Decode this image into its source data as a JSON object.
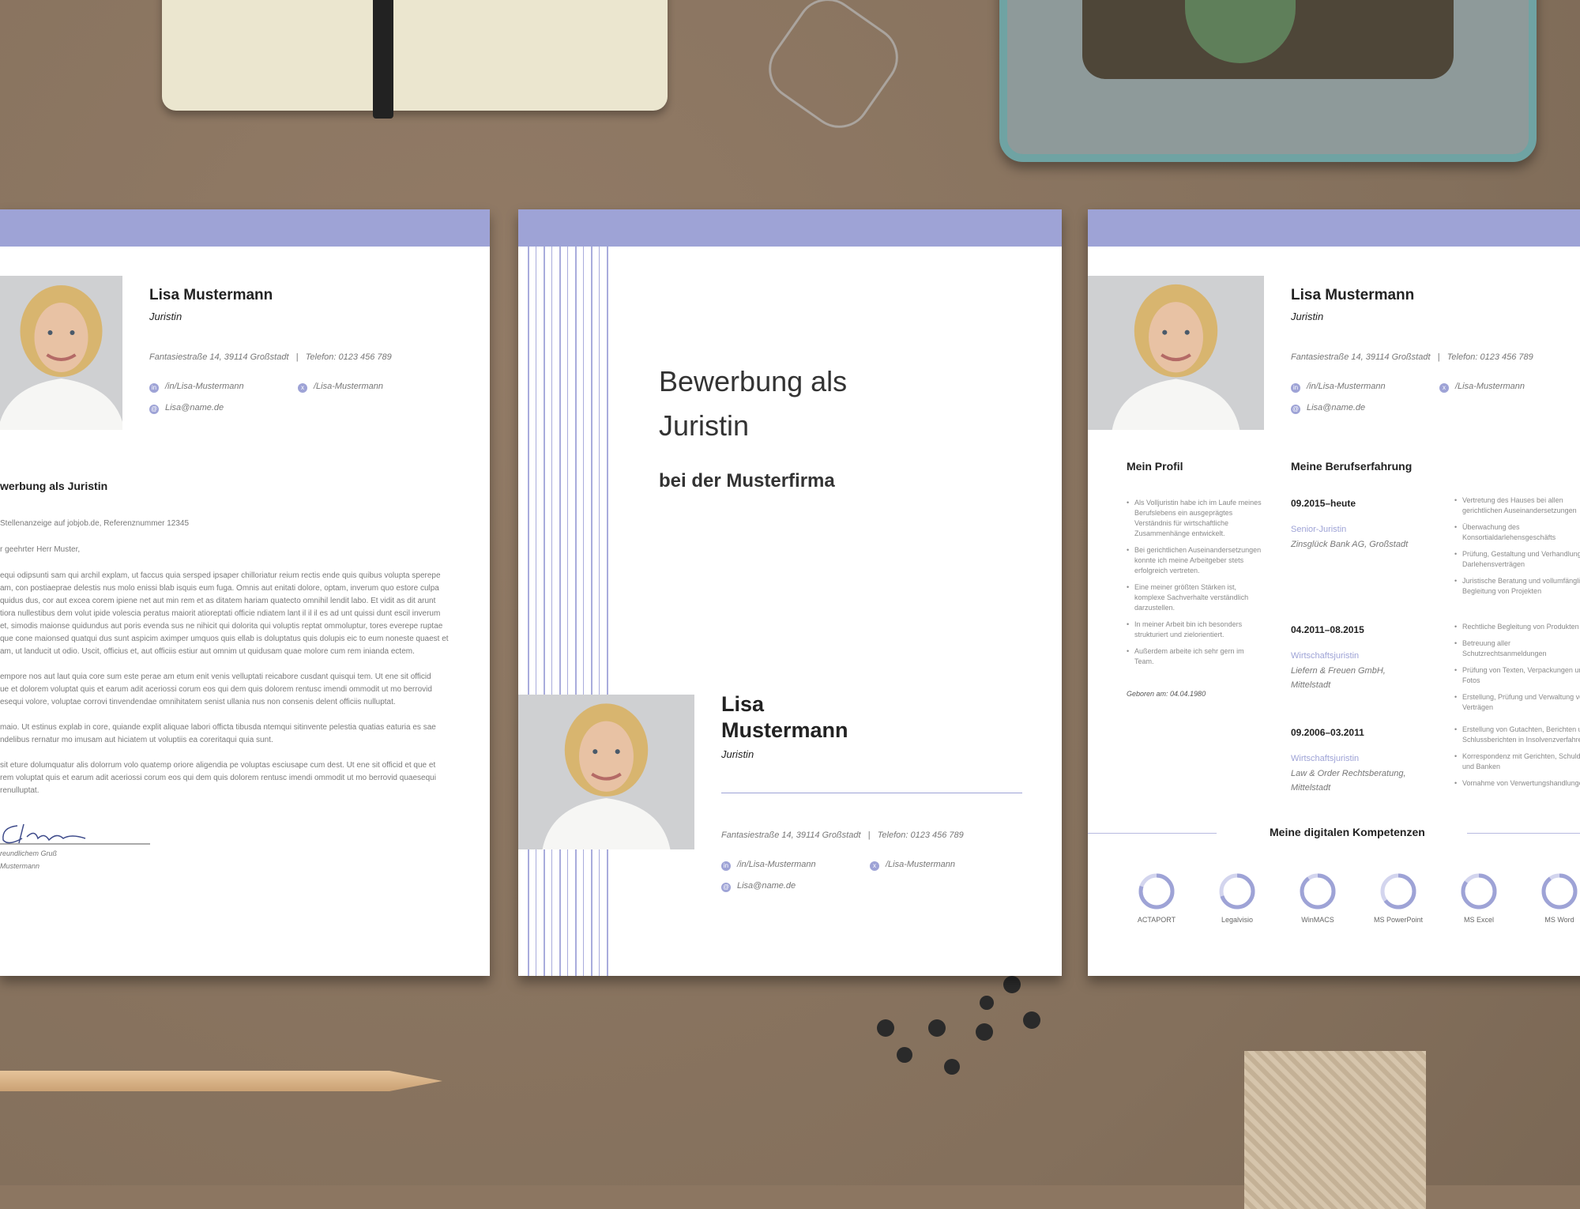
{
  "accent_color": "#9ea3d6",
  "person": {
    "name": "Lisa Mustermann",
    "name_line1": "Lisa",
    "name_line2": "Mustermann",
    "role": "Juristin",
    "address": "Fantasiestraße 14, 39114 Großstadt   |   Telefon: 0123 456 789",
    "linkedin": "/in/Lisa-Mustermann",
    "xing": "/Lisa-Mustermann",
    "email": "Lisa@name.de"
  },
  "icons": {
    "linkedin": "linkedin-icon",
    "xing": "xing-icon",
    "email": "at-icon"
  },
  "letter": {
    "subject": "werbung als Juristin",
    "reference": "Stellenanzeige auf jobjob.de, Referenznummer 12345",
    "salutation": "r geehrter Herr Muster,",
    "paragraphs": [
      [
        "equi odipsunti sam qui archil explam, ut faccus quia sersped ipsaper chilloriatur reium rectis ende quis quibus volupta sperepe",
        "am, con postiaeprae delestis nus molo enissi blab isquis eum fuga. Omnis aut enitati dolore, optam, inverum quo estore culpa",
        "quidus dus, cor aut excea corem ipiene net aut min rem et as ditatem hariam quatecto omnihil lendit labo. Et vidit as dit arunt",
        "tiora nullestibus dem volut ipide volescia peratus maiorit atioreptati officie ndiatem lant il il il es ad unt quissi dunt escil inverum",
        "et, simodis maionse quidundus aut poris evenda sus ne nihicit qui dolorita qui voluptis reptat ommoluptur, tores everepe ruptae",
        "que cone maionsed quatqui dus sunt aspicim aximper umquos quis ellab is doluptatus quis dolupis eic to eum noneste quaest et",
        "am, ut landucit ut odio. Uscit, officius et, aut officiis estiur aut omnim ut quidusam quae molore cum rem inianda ectem."
      ],
      [
        "empore nos aut laut quia core sum este perae am etum enit venis velluptati reicabore cusdant quisqui tem. Ut ene sit officid",
        "ue et dolorem voluptat quis et earum adit aceriossi corum eos qui dem quis dolorem rentusc imendi ommodit ut mo berrovid",
        "esequi volore, voluptae corrovi tinvendendae omnihitatem senist ullania nus non consenis delent officiis nulluptat."
      ],
      [
        "maio. Ut estinus explab in core, quiande explit aliquae labori officta tibusda ntemqui sitinvente pelestia quatias eaturia es sae",
        "ndelibus rernatur mo imusam aut hiciatem ut voluptiis ea coreritaqui quia sunt."
      ],
      [
        "sit eture dolumquatur alis dolorrum volo quatemp oriore aligendia pe voluptas esciusape cum dest. Ut ene sit officid et que et",
        "rem voluptat quis et earum adit aceriossi corum eos qui dem quis dolorem rentusc imendi ommodit ut mo berrovid quaesequi",
        "renulluptat."
      ]
    ],
    "closing": "reundlichem Gruß",
    "closing_name": "Mustermann"
  },
  "cover": {
    "title_line1": "Bewerbung als",
    "title_line2": "Juristin",
    "subtitle": "bei der Musterfirma"
  },
  "cv": {
    "profile_heading": "Mein Profil",
    "profile": [
      "Als Volljuristin habe ich im Laufe meines Berufslebens ein ausgeprägtes Verständnis für wirtschaftliche Zusammenhänge entwickelt.",
      "Bei gerichtlichen Auseinandersetzungen konnte ich meine Arbeitgeber stets erfolgreich vertreten.",
      "Eine meiner größten Stärken ist, komplexe Sachverhalte verständlich darzustellen.",
      "In meiner Arbeit bin ich besonders strukturiert und zielorientiert.",
      "Außerdem arbeite ich sehr gern im Team."
    ],
    "born": "Geboren am: 04.04.1980",
    "experience_heading": "Meine Berufserfahrung",
    "jobs": [
      {
        "dates": "09.2015–heute",
        "title": "Senior-Juristin",
        "company": "Zinsglück Bank AG, Großstadt",
        "tasks": [
          "Vertretung des Hauses bei allen gerichtlichen Auseinandersetzungen",
          "Überwachung des Konsortialdarlehensgeschäfts",
          "Prüfung, Gestaltung und Verhandlung von Darlehensverträgen",
          "Juristische Beratung und vollumfängliche Begleitung von Projekten"
        ]
      },
      {
        "dates": "04.2011–08.2015",
        "title": "Wirtschaftsjuristin",
        "company": "Liefern & Freuen GmbH, Mittelstadt",
        "tasks": [
          "Rechtliche Begleitung von Produkten",
          "Betreuung aller Schutzrechtsanmeldungen",
          "Prüfung von Texten, Verpackungen und Fotos",
          "Erstellung, Prüfung und Verwaltung von Verträgen"
        ]
      },
      {
        "dates": "09.2006–03.2011",
        "title": "Wirtschaftsjuristin",
        "company": "Law & Order Rechtsberatung, Mittelstadt",
        "tasks": [
          "Erstellung von Gutachten, Berichten und Schlussberichten in Insolvenzverfahren",
          "Korrespondenz mit Gerichten, Schuldnern und Banken",
          "Vornahme von Verwertungshandlungen"
        ]
      }
    ],
    "skills_heading": "Meine digitalen Kompetenzen",
    "skills": [
      {
        "name": "ACTAPORT",
        "level": 0.8
      },
      {
        "name": "Legalvisio",
        "level": 0.7
      },
      {
        "name": "WinMACS",
        "level": 0.9
      },
      {
        "name": "MS PowerPoint",
        "level": 0.65
      },
      {
        "name": "MS Excel",
        "level": 0.85
      },
      {
        "name": "MS Word",
        "level": 0.9
      }
    ]
  }
}
